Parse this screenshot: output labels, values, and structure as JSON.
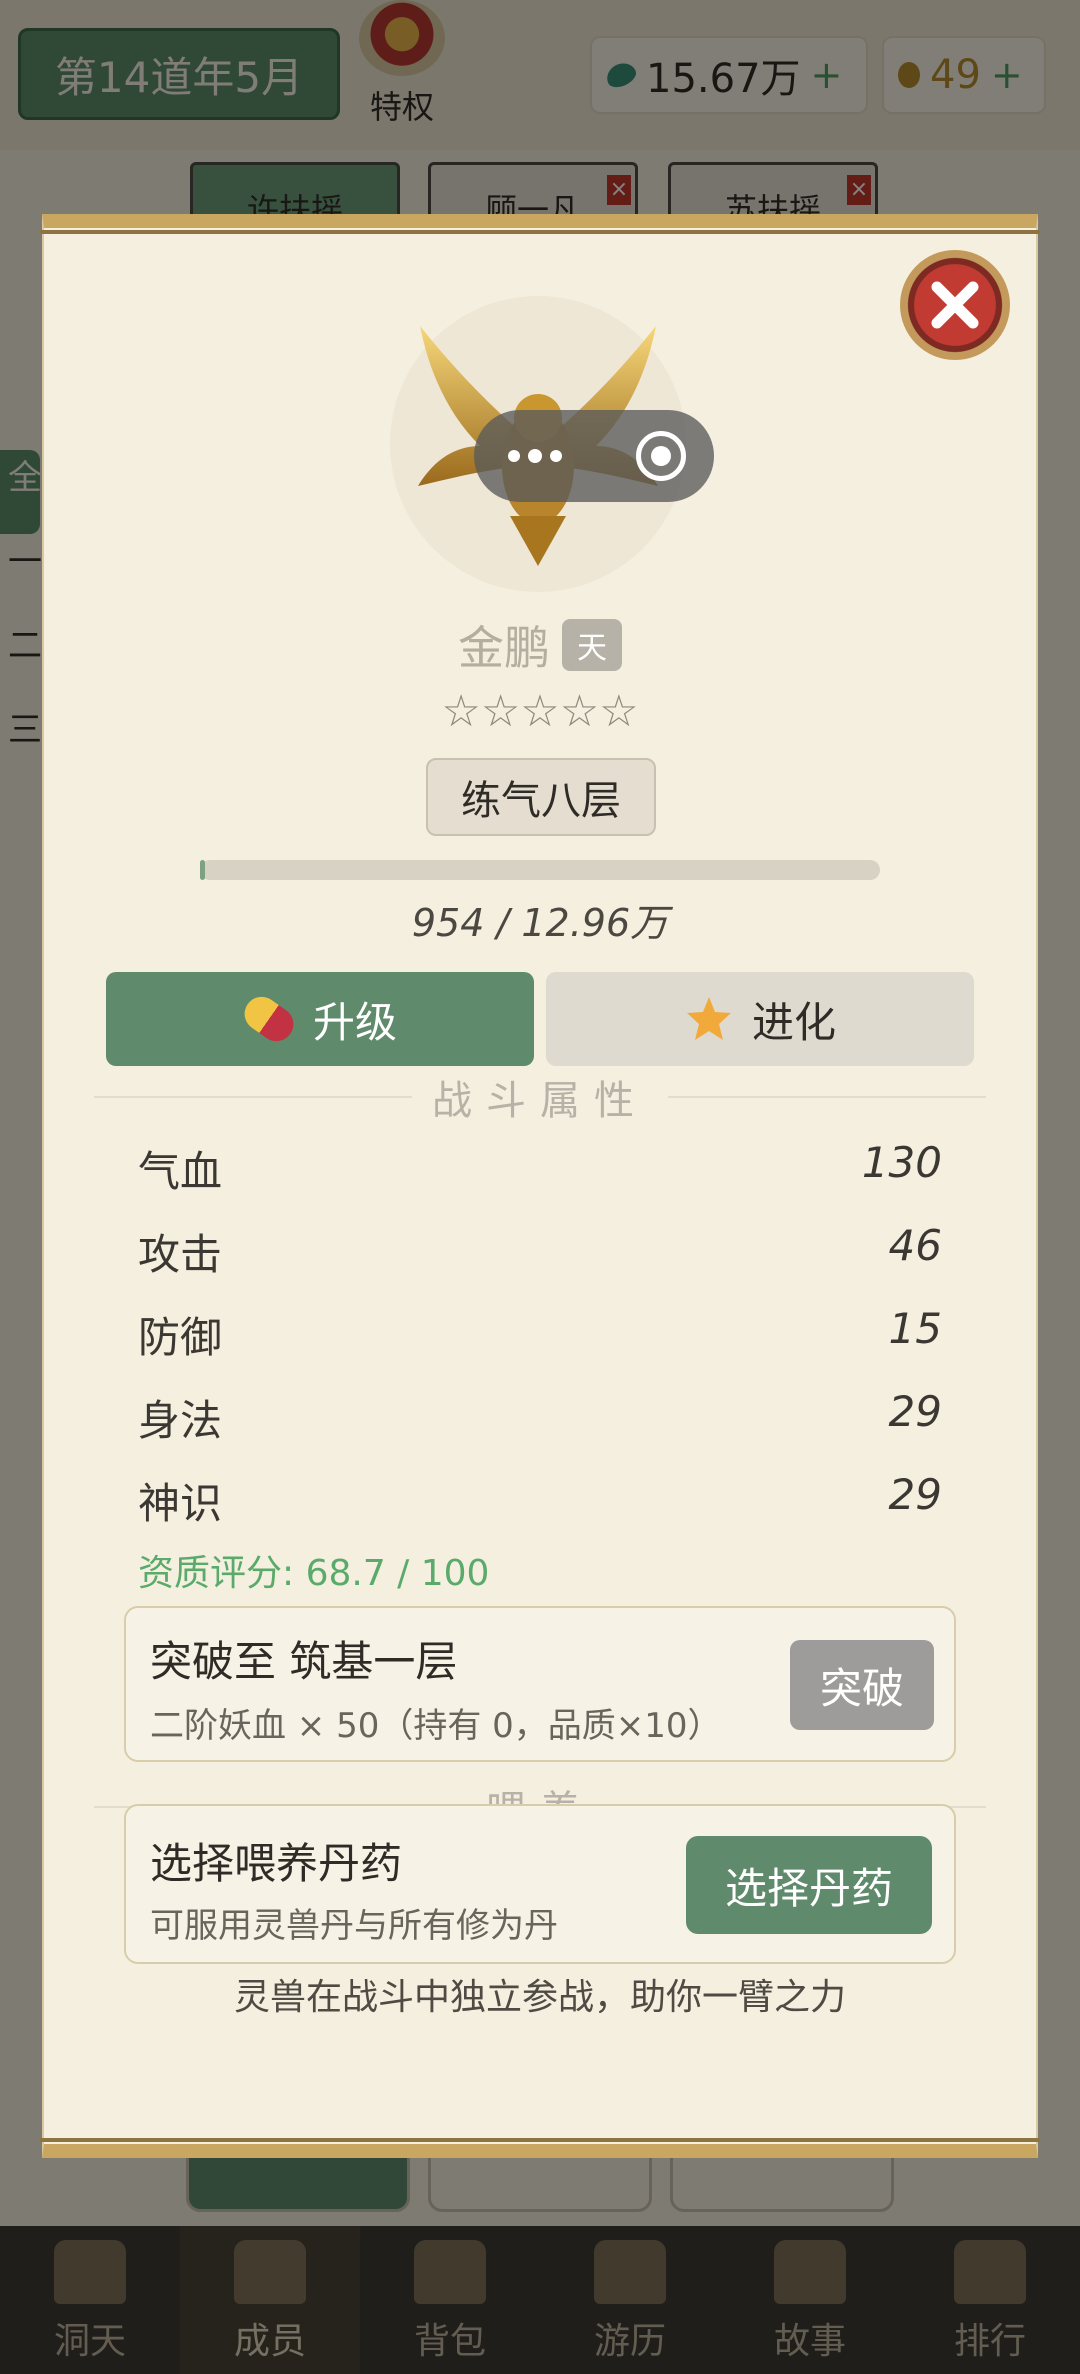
{
  "app": {
    "date_label": "第14道年5月",
    "privilege_label": "特权",
    "resources": [
      {
        "icon": "jade-gem-icon",
        "value": "15.67万",
        "plus": "+"
      },
      {
        "icon": "gold-coin-icon",
        "value": "49",
        "plus": "+"
      }
    ],
    "member_tabs": [
      {
        "label": "许扶摇",
        "closable": false
      },
      {
        "label": "顾一凡",
        "closable": true
      },
      {
        "label": "苏扶摇",
        "closable": true
      }
    ],
    "close_mark": "×",
    "side_items": [
      "全",
      "一",
      "二",
      "三"
    ],
    "bottom_nav": [
      {
        "label": "洞天",
        "icon": "cave-icon"
      },
      {
        "label": "成员",
        "icon": "members-icon"
      },
      {
        "label": "背包",
        "icon": "bag-icon"
      },
      {
        "label": "游历",
        "icon": "travel-icon"
      },
      {
        "label": "故事",
        "icon": "book-icon"
      },
      {
        "label": "排行",
        "icon": "ranking-icon"
      }
    ]
  },
  "pet": {
    "name": "金鹏",
    "grade": "天",
    "stars": "☆☆☆☆☆",
    "star_count": 0,
    "realm": "练气八层",
    "exp_text": "954 / 12.96万",
    "exp_fraction": 0.0074
  },
  "tabs": {
    "upgrade": "升级",
    "evolve": "进化"
  },
  "combat_section": {
    "title": "战斗属性",
    "stats": [
      {
        "label": "气血",
        "value": "130"
      },
      {
        "label": "攻击",
        "value": "46"
      },
      {
        "label": "防御",
        "value": "15"
      },
      {
        "label": "身法",
        "value": "29"
      },
      {
        "label": "神识",
        "value": "29"
      }
    ],
    "aptitude": "资质评分: 68.7 / 100"
  },
  "breakthrough": {
    "title": "突破至 筑基一层",
    "requirement": "二阶妖血 × 50（持有 0，品质×10）",
    "button": "突破"
  },
  "feed_section": {
    "title": "喂养",
    "card_title": "选择喂养丹药",
    "card_sub": "可服用灵兽丹与所有修为丹",
    "button": "选择丹药"
  },
  "footer_note": "灵兽在战斗中独立参战，助你一臂之力",
  "colors": {
    "primary_green": "#5f8a6b",
    "gold_frame": "#c9a760",
    "close_red": "#c23b33",
    "aptitude_green": "#5aab6b"
  }
}
